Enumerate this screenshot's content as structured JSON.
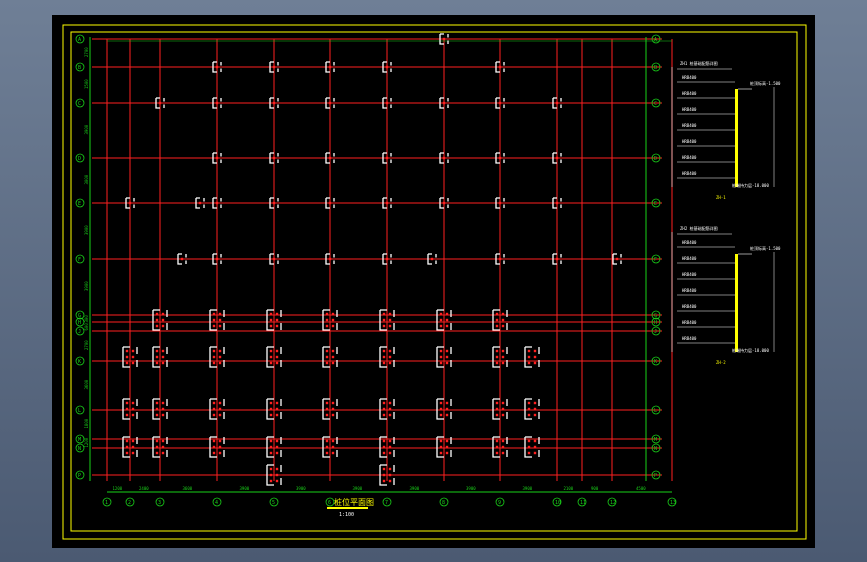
{
  "colors": {
    "background": "#000000",
    "frame": "#ffff00",
    "grid_red": "#ff2020",
    "dim_green": "#19d219",
    "column_white": "#ffffff",
    "column_bar_yellow": "#ffff00"
  },
  "drawing": {
    "title_label": "桩位平面图",
    "scale_note": "1:100",
    "col_axis_labels": [
      "1",
      "2",
      "3",
      "4",
      "5",
      "6",
      "7",
      "8",
      "9",
      "10",
      "11",
      "12",
      "13",
      "14"
    ],
    "row_axis_labels": [
      "A",
      "B",
      "C",
      "D",
      "E",
      "F",
      "G",
      "H",
      "J",
      "K",
      "L",
      "M",
      "N",
      "P"
    ],
    "col_dim_values": [
      "1200",
      "2400",
      "3600",
      "3900",
      "3900",
      "3900",
      "3900",
      "3900",
      "3900",
      "2100",
      "900",
      "4500"
    ],
    "row_dim_values": [
      "2700",
      "1500",
      "3900",
      "3000",
      "3900",
      "3900",
      "300",
      "600",
      "2700",
      "3600",
      "1800",
      "1200"
    ]
  },
  "schedules": [
    {
      "heading": "ZH1 桩基础配筋详图",
      "side_label": "桩顶标高-1.500",
      "rows": [
        "HRB400",
        "HRB400",
        "HRB400",
        "HRB400",
        "HRB400",
        "HRB400",
        "HRB400"
      ],
      "caption": "ZH-1",
      "footer": "桩端持力层-18.000"
    },
    {
      "heading": "ZH2 桩基础配筋详图",
      "side_label": "桩顶标高-1.500",
      "rows": [
        "HRB400",
        "HRB400",
        "HRB400",
        "HRB400",
        "HRB400",
        "HRB400",
        "HRB400"
      ],
      "caption": "ZH-2",
      "footer": "桩端持力层-18.000"
    }
  ]
}
